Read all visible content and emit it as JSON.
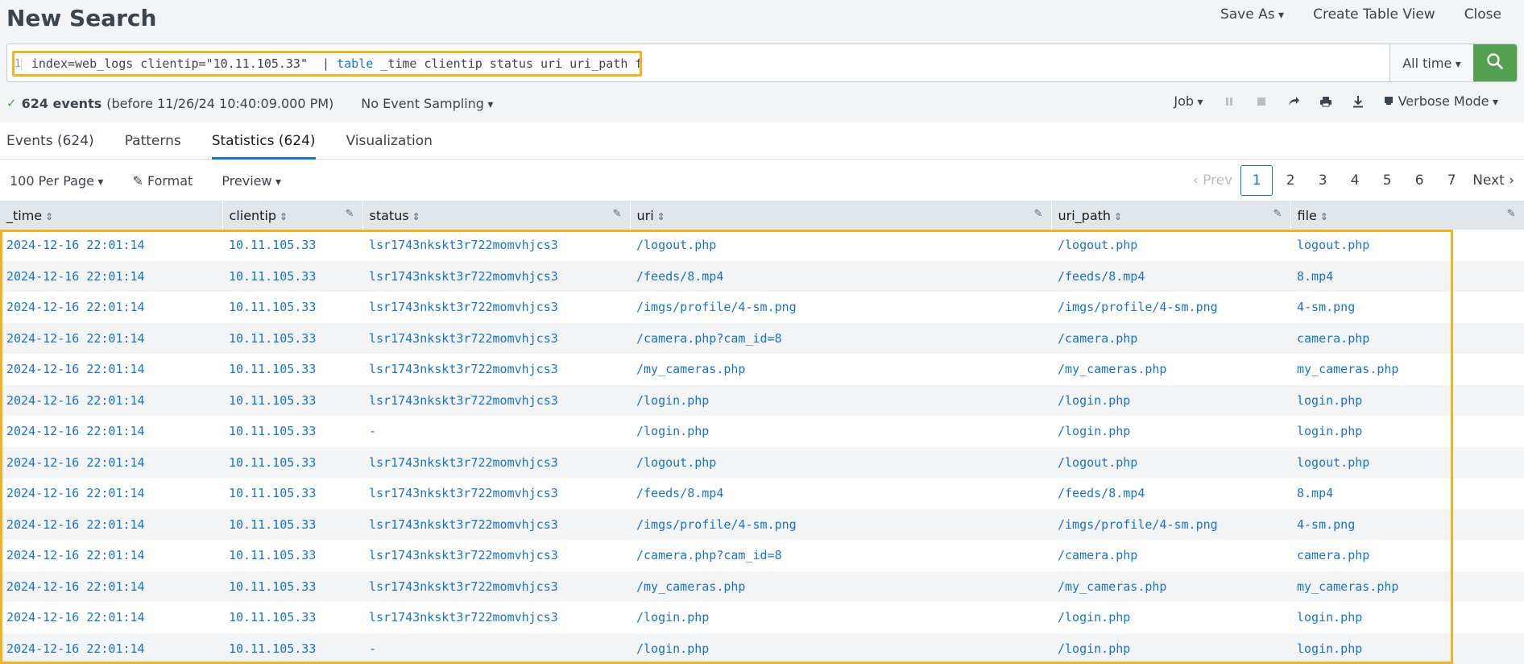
{
  "header": {
    "title": "New Search",
    "save_as": "Save As",
    "create_table_view": "Create Table View",
    "close": "Close"
  },
  "search": {
    "line_number": "1",
    "query_prefix": "index=web_logs clientip=\"10.11.105.33\"  | ",
    "query_command": "table",
    "query_suffix": " _time clientip status uri uri_path file",
    "time_range": "All time"
  },
  "status": {
    "events_count": "624 events",
    "events_detail": "(before 11/26/24 10:40:09.000 PM)",
    "sampling": "No Event Sampling",
    "job": "Job",
    "mode": "Verbose Mode"
  },
  "tabs": [
    {
      "label": "Events (624)"
    },
    {
      "label": "Patterns"
    },
    {
      "label": "Statistics (624)"
    },
    {
      "label": "Visualization"
    }
  ],
  "toolbar": {
    "per_page": "100 Per Page",
    "format": "Format",
    "preview": "Preview"
  },
  "pager": {
    "prev": "Prev",
    "next": "Next",
    "pages": [
      "1",
      "2",
      "3",
      "4",
      "5",
      "6",
      "7"
    ],
    "current": "1"
  },
  "table": {
    "columns": [
      "_time",
      "clientip",
      "status",
      "uri",
      "uri_path",
      "file"
    ],
    "rows": [
      [
        "2024-12-16 22:01:14",
        "10.11.105.33",
        "lsr1743nkskt3r722momvhjcs3",
        "/logout.php",
        "/logout.php",
        "logout.php"
      ],
      [
        "2024-12-16 22:01:14",
        "10.11.105.33",
        "lsr1743nkskt3r722momvhjcs3",
        "/feeds/8.mp4",
        "/feeds/8.mp4",
        "8.mp4"
      ],
      [
        "2024-12-16 22:01:14",
        "10.11.105.33",
        "lsr1743nkskt3r722momvhjcs3",
        "/imgs/profile/4-sm.png",
        "/imgs/profile/4-sm.png",
        "4-sm.png"
      ],
      [
        "2024-12-16 22:01:14",
        "10.11.105.33",
        "lsr1743nkskt3r722momvhjcs3",
        "/camera.php?cam_id=8",
        "/camera.php",
        "camera.php"
      ],
      [
        "2024-12-16 22:01:14",
        "10.11.105.33",
        "lsr1743nkskt3r722momvhjcs3",
        "/my_cameras.php",
        "/my_cameras.php",
        "my_cameras.php"
      ],
      [
        "2024-12-16 22:01:14",
        "10.11.105.33",
        "lsr1743nkskt3r722momvhjcs3",
        "/login.php",
        "/login.php",
        "login.php"
      ],
      [
        "2024-12-16 22:01:14",
        "10.11.105.33",
        "-",
        "/login.php",
        "/login.php",
        "login.php"
      ],
      [
        "2024-12-16 22:01:14",
        "10.11.105.33",
        "lsr1743nkskt3r722momvhjcs3",
        "/logout.php",
        "/logout.php",
        "logout.php"
      ],
      [
        "2024-12-16 22:01:14",
        "10.11.105.33",
        "lsr1743nkskt3r722momvhjcs3",
        "/feeds/8.mp4",
        "/feeds/8.mp4",
        "8.mp4"
      ],
      [
        "2024-12-16 22:01:14",
        "10.11.105.33",
        "lsr1743nkskt3r722momvhjcs3",
        "/imgs/profile/4-sm.png",
        "/imgs/profile/4-sm.png",
        "4-sm.png"
      ],
      [
        "2024-12-16 22:01:14",
        "10.11.105.33",
        "lsr1743nkskt3r722momvhjcs3",
        "/camera.php?cam_id=8",
        "/camera.php",
        "camera.php"
      ],
      [
        "2024-12-16 22:01:14",
        "10.11.105.33",
        "lsr1743nkskt3r722momvhjcs3",
        "/my_cameras.php",
        "/my_cameras.php",
        "my_cameras.php"
      ],
      [
        "2024-12-16 22:01:14",
        "10.11.105.33",
        "lsr1743nkskt3r722momvhjcs3",
        "/login.php",
        "/login.php",
        "login.php"
      ],
      [
        "2024-12-16 22:01:14",
        "10.11.105.33",
        "-",
        "/login.php",
        "/login.php",
        "login.php"
      ]
    ]
  },
  "colors": {
    "accent": "#1a73c8",
    "search_button": "#53a051",
    "highlight": "#f0b323"
  },
  "icons": {
    "search": "search-icon",
    "pause": "pause-icon",
    "stop": "stop-icon",
    "share": "share-icon",
    "print": "print-icon",
    "export": "download-icon",
    "mode": "mode-icon",
    "format": "pencil-icon"
  }
}
